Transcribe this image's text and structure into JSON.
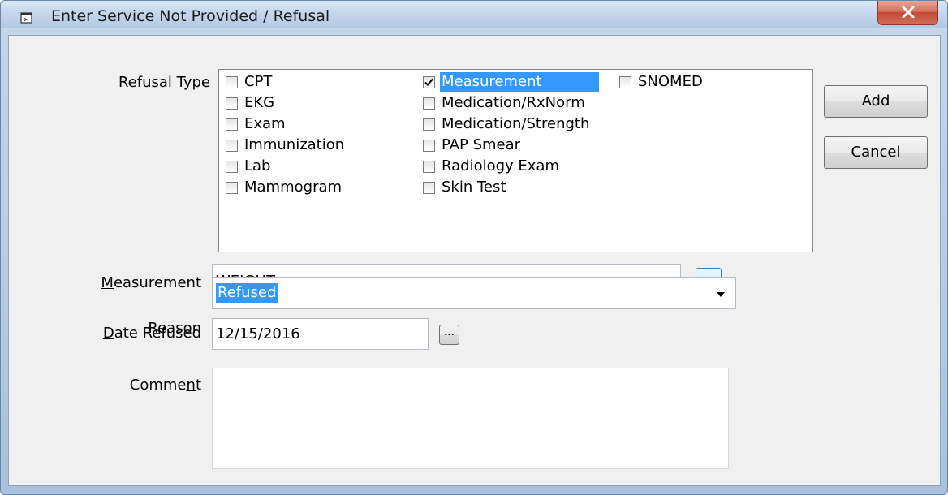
{
  "window": {
    "title": "Enter Service Not Provided / Refusal",
    "close_label": "x"
  },
  "refusal_type": {
    "label_pre": "Refusal ",
    "label_key": "T",
    "label_post": "ype",
    "options": [
      {
        "label": "CPT",
        "checked": false
      },
      {
        "label": "EKG",
        "checked": false
      },
      {
        "label": "Exam",
        "checked": false
      },
      {
        "label": "Immunization",
        "checked": false
      },
      {
        "label": "Lab",
        "checked": false
      },
      {
        "label": "Mammogram",
        "checked": false
      },
      {
        "label": "Measurement",
        "checked": true
      },
      {
        "label": "Medication/RxNorm",
        "checked": false
      },
      {
        "label": "Medication/Strength",
        "checked": false
      },
      {
        "label": "PAP Smear",
        "checked": false
      },
      {
        "label": "Radiology Exam",
        "checked": false
      },
      {
        "label": "Skin Test",
        "checked": false
      },
      {
        "label": "SNOMED",
        "checked": false
      }
    ]
  },
  "buttons": {
    "add": "Add",
    "cancel": "Cancel",
    "ellipsis": "..."
  },
  "measurement": {
    "label_key": "M",
    "label_rest": "easurement",
    "value": "WEIGHT"
  },
  "reason": {
    "label_key": "R",
    "label_rest": "eason",
    "value": "Refused"
  },
  "date_refused": {
    "label_key": "D",
    "label_rest": "ate Refused",
    "value": "12/15/2016"
  },
  "comment": {
    "label_pre": "Comme",
    "label_key": "n",
    "label_post": "t",
    "value": ""
  }
}
